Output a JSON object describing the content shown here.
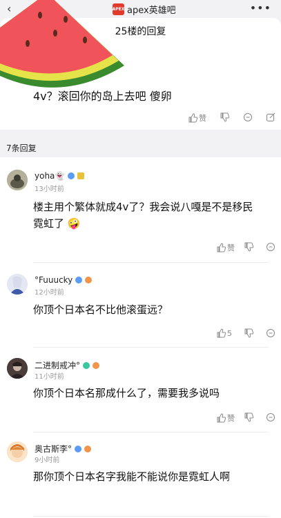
{
  "topbar": {
    "back_icon": "chevron-left-icon",
    "bar_logo_text": "APEX",
    "bar_name": "apex英雄吧",
    "more_icon": "more-dots-icon"
  },
  "sheet": {
    "title": "25楼的回复",
    "main_text": "4v？滚回你的岛上去吧 傻卵",
    "actions": {
      "like_label": "赞"
    }
  },
  "reply_count": "7条回复",
  "replies": [
    {
      "user": "yoha👻",
      "time": "13小时前",
      "content": "楼主用个繁体就成4v了？我会说八嘎是不是移民\n霓虹了 🤪",
      "like": "赞"
    },
    {
      "user": "°Fuuucky",
      "time": "12小时前",
      "content": "你顶个日本名不比他滚蛋远？",
      "like": "5"
    },
    {
      "user": "二进制戒冲°",
      "time": "11小时前",
      "content": "你顶个日本名那成什么了，需要我多说吗",
      "like": "赞"
    },
    {
      "user": "奥古斯李°",
      "time": "9小时前",
      "content": "那你顶个日本名字我能不能说你是霓虹人啊",
      "like": ""
    }
  ],
  "colors": {
    "accent_blue": "#5b9df5",
    "watermelon_red": "#f0545a",
    "rind_green": "#3a8a2e",
    "rind_yellow": "#e6e34a"
  }
}
